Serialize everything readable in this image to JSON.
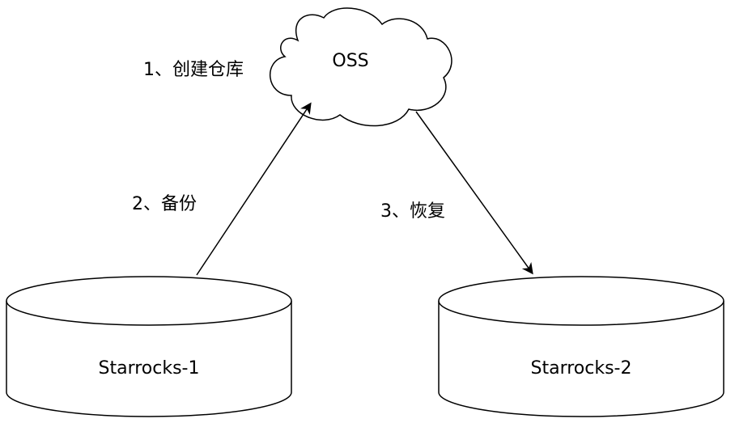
{
  "nodes": {
    "oss": {
      "label": "OSS",
      "shape": "cloud"
    },
    "starrocks_1": {
      "label": "Starrocks-1",
      "shape": "cylinder"
    },
    "starrocks_2": {
      "label": "Starrocks-2",
      "shape": "cylinder"
    }
  },
  "edges": {
    "create_repo": {
      "label": "1、创建仓库"
    },
    "backup": {
      "label": "2、备份",
      "from": "starrocks_1",
      "to": "oss"
    },
    "restore": {
      "label": "3、恢复",
      "from": "oss",
      "to": "starrocks_2"
    }
  },
  "colors": {
    "stroke": "#000000",
    "fill": "#ffffff",
    "text": "#000000"
  }
}
